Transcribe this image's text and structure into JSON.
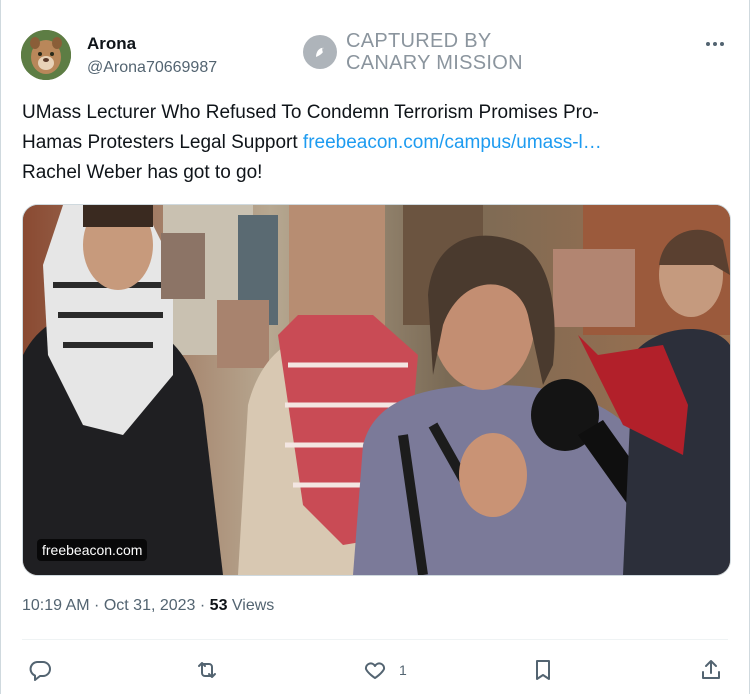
{
  "tweet": {
    "author": {
      "display_name": "Arona",
      "handle": "@Arona70669987",
      "avatar_icon": "cougar-avatar"
    },
    "watermark": {
      "line1": "CAPTURED BY",
      "line2": "CANARY MISSION",
      "icon": "canary-bird-icon"
    },
    "text": {
      "line1": "UMass Lecturer Who Refused To Condemn Terrorism Promises Pro-",
      "line2_prefix": "Hamas Protesters Legal Support ",
      "link": "freebeacon.com/campus/umass-l…",
      "line3": "Rachel Weber has got to go!"
    },
    "media": {
      "source_label": "freebeacon.com"
    },
    "meta": {
      "time": "10:19 AM",
      "sep1": " · ",
      "date": "Oct 31, 2023",
      "sep2": " · ",
      "views_count": "53",
      "views_label": " Views"
    },
    "actions": {
      "reply_count": "",
      "retweet_count": "",
      "like_count": "1",
      "bookmark_count": ""
    }
  },
  "colors": {
    "link": "#1d9bf0",
    "secondary_text": "#536471",
    "border": "#cfd9de"
  }
}
